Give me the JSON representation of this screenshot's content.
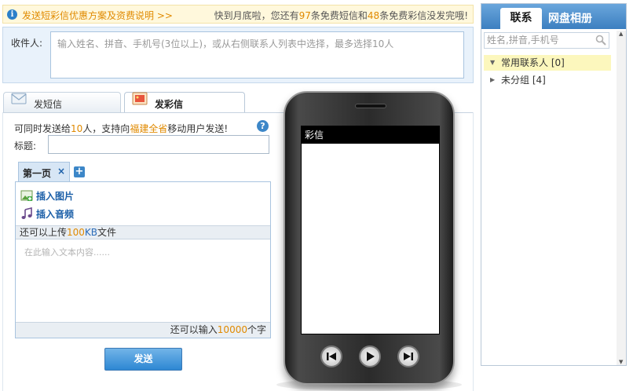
{
  "notice": {
    "promo_link": "发送短彩信优惠方案及资费说明 >>",
    "quota_prefix": "快到月底啦，您还有",
    "sms_free_count": "97",
    "quota_mid1": "条免费短信和",
    "mms_free_count": "48",
    "quota_suffix": "条免费彩信没发完哦!"
  },
  "recipient": {
    "label": "收件人:",
    "placeholder": "输入姓名、拼音、手机号(3位以上)，或从右侧联系人列表中选择，最多选择10人"
  },
  "tabs": [
    {
      "label": "发短信"
    },
    {
      "label": "发彩信"
    }
  ],
  "compose": {
    "hint_prefix": "可同时发送给",
    "hint_count": "10",
    "hint_mid": "人，支持向",
    "hint_region": "福建全省",
    "hint_suffix": "移动用户发送!",
    "help": "?",
    "title_label": "标题:",
    "page_tab": "第一页",
    "page_close": "×",
    "add_page": "+",
    "insert_image": "插入图片",
    "insert_audio": "插入音频",
    "upload_prefix": "还可以上传",
    "upload_size": "100",
    "upload_unit": "KB",
    "upload_suffix": "文件",
    "text_placeholder": "在此输入文本内容......",
    "counter_prefix": "还可以输入",
    "counter_value": "10000",
    "counter_suffix": "个字",
    "send_label": "发送"
  },
  "phone": {
    "screen_title": "彩信"
  },
  "sidebar": {
    "tab_contacts": "联系",
    "tab_album": "网盘相册",
    "search_placeholder": "姓名,拼音,手机号",
    "groups": [
      {
        "label": "常用联系人 [0]",
        "expanded": true
      },
      {
        "label": "未分组 [4]",
        "expanded": false
      }
    ]
  },
  "colors": {
    "accent_orange": "#e08a00",
    "link_blue": "#1b5fa8",
    "tab_blue": "#3c7fc0"
  }
}
